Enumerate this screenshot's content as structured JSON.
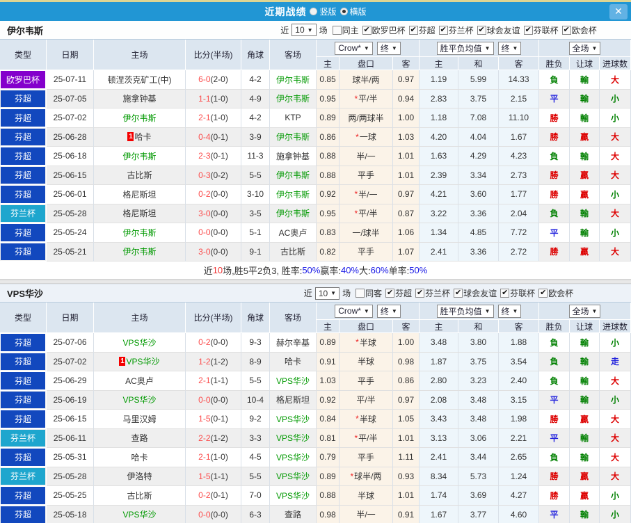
{
  "window": {
    "title": "近期战绩",
    "views": [
      {
        "label": "竖版",
        "selected": false
      },
      {
        "label": "横版",
        "selected": true
      }
    ],
    "close_icon": "✕"
  },
  "columns": {
    "left": [
      "类型",
      "日期",
      "主场",
      "比分(半场)",
      "角球",
      "客场"
    ],
    "sub": [
      "主",
      "盘口",
      "客",
      "主",
      "和",
      "客",
      "胜负",
      "让球",
      "进球数"
    ],
    "selects": {
      "odds_source": "Crow*",
      "odds_state": "终",
      "avg_source": "胜平负均值",
      "avg_state": "终",
      "scope": "全场"
    },
    "dropdown_icon": "▼",
    "check_icon": "✔"
  },
  "colors": {
    "titlebar": "#2196d4",
    "score_red": "#fb4b4b",
    "team_green": "#009900",
    "league": {
      "芬超": "#1248be",
      "芬兰杯": "#1ea6ce",
      "欧罗巴杯": "#8400cc"
    },
    "outcome": {
      "勝": "#dd0000",
      "贏": "#dd0000",
      "大": "#dd0000",
      "負": "#008000",
      "輸": "#008000",
      "小": "#008000",
      "平": "#2222dd",
      "走": "#2222dd"
    },
    "summary": {
      "dark": "#333333",
      "red": "#ee3333",
      "blue": "#1818e6"
    }
  },
  "sections": [
    {
      "team": "伊尔韦斯",
      "filter": {
        "prefix": "近",
        "count": "10",
        "suffix": "场",
        "same_label": "同主",
        "same_checked": false,
        "leagues": [
          {
            "label": "欧罗巴杯",
            "checked": true
          },
          {
            "label": "芬超",
            "checked": true
          },
          {
            "label": "芬兰杯",
            "checked": true
          },
          {
            "label": "球会友谊",
            "checked": true
          },
          {
            "label": "芬联杯",
            "checked": true
          },
          {
            "label": "欧会杯",
            "checked": true
          }
        ]
      },
      "rows": [
        {
          "type": "欧罗巴杯",
          "date": "25-07-11",
          "home": {
            "name": "顿涅茨克矿工(中)",
            "self": false,
            "card": false
          },
          "score": "6-0",
          "half": "(2-0)",
          "corner": "4-2",
          "away": {
            "name": "伊尔韦斯",
            "self": true,
            "card": false
          },
          "crow": {
            "home": "0.85",
            "star": false,
            "handicap": "球半/两",
            "away": "0.97"
          },
          "avg": {
            "home": "1.19",
            "draw": "5.99",
            "away": "14.33"
          },
          "result": "負",
          "spread": "輸",
          "goals": "大"
        },
        {
          "type": "芬超",
          "date": "25-07-05",
          "home": {
            "name": "施拿钟基",
            "self": false,
            "card": false
          },
          "score": "1-1",
          "half": "(1-0)",
          "corner": "4-9",
          "away": {
            "name": "伊尔韦斯",
            "self": true,
            "card": false
          },
          "crow": {
            "home": "0.95",
            "star": true,
            "handicap": "平/半",
            "away": "0.94"
          },
          "avg": {
            "home": "2.83",
            "draw": "3.75",
            "away": "2.15"
          },
          "result": "平",
          "spread": "輸",
          "goals": "小"
        },
        {
          "type": "芬超",
          "date": "25-07-02",
          "home": {
            "name": "伊尔韦斯",
            "self": true,
            "card": false
          },
          "score": "2-1",
          "half": "(1-0)",
          "corner": "4-2",
          "away": {
            "name": "KTP",
            "self": false,
            "card": false
          },
          "crow": {
            "home": "0.89",
            "star": false,
            "handicap": "两/两球半",
            "away": "1.00"
          },
          "avg": {
            "home": "1.18",
            "draw": "7.08",
            "away": "11.10"
          },
          "result": "勝",
          "spread": "輸",
          "goals": "小"
        },
        {
          "type": "芬超",
          "date": "25-06-28",
          "home": {
            "name": "哈卡",
            "self": false,
            "card": true
          },
          "score": "0-4",
          "half": "(0-1)",
          "corner": "3-9",
          "away": {
            "name": "伊尔韦斯",
            "self": true,
            "card": false
          },
          "crow": {
            "home": "0.86",
            "star": true,
            "handicap": "一球",
            "away": "1.03"
          },
          "avg": {
            "home": "4.20",
            "draw": "4.04",
            "away": "1.67"
          },
          "result": "勝",
          "spread": "贏",
          "goals": "大"
        },
        {
          "type": "芬超",
          "date": "25-06-18",
          "home": {
            "name": "伊尔韦斯",
            "self": true,
            "card": false
          },
          "score": "2-3",
          "half": "(0-1)",
          "corner": "11-3",
          "away": {
            "name": "施拿钟基",
            "self": false,
            "card": false
          },
          "crow": {
            "home": "0.88",
            "star": false,
            "handicap": "半/一",
            "away": "1.01"
          },
          "avg": {
            "home": "1.63",
            "draw": "4.29",
            "away": "4.23"
          },
          "result": "負",
          "spread": "輸",
          "goals": "大"
        },
        {
          "type": "芬超",
          "date": "25-06-15",
          "home": {
            "name": "古比斯",
            "self": false,
            "card": false
          },
          "score": "0-3",
          "half": "(0-2)",
          "corner": "5-5",
          "away": {
            "name": "伊尔韦斯",
            "self": true,
            "card": false
          },
          "crow": {
            "home": "0.88",
            "star": false,
            "handicap": "平手",
            "away": "1.01"
          },
          "avg": {
            "home": "2.39",
            "draw": "3.34",
            "away": "2.73"
          },
          "result": "勝",
          "spread": "贏",
          "goals": "大"
        },
        {
          "type": "芬超",
          "date": "25-06-01",
          "home": {
            "name": "格尼斯坦",
            "self": false,
            "card": false
          },
          "score": "0-2",
          "half": "(0-0)",
          "corner": "3-10",
          "away": {
            "name": "伊尔韦斯",
            "self": true,
            "card": false
          },
          "crow": {
            "home": "0.92",
            "star": true,
            "handicap": "半/一",
            "away": "0.97"
          },
          "avg": {
            "home": "4.21",
            "draw": "3.60",
            "away": "1.77"
          },
          "result": "勝",
          "spread": "贏",
          "goals": "小"
        },
        {
          "type": "芬兰杯",
          "date": "25-05-28",
          "home": {
            "name": "格尼斯坦",
            "self": false,
            "card": false
          },
          "score": "3-0",
          "half": "(0-0)",
          "corner": "3-5",
          "away": {
            "name": "伊尔韦斯",
            "self": true,
            "card": false
          },
          "crow": {
            "home": "0.95",
            "star": true,
            "handicap": "平/半",
            "away": "0.87"
          },
          "avg": {
            "home": "3.22",
            "draw": "3.36",
            "away": "2.04"
          },
          "result": "負",
          "spread": "輸",
          "goals": "大"
        },
        {
          "type": "芬超",
          "date": "25-05-24",
          "home": {
            "name": "伊尔韦斯",
            "self": true,
            "card": false
          },
          "score": "0-0",
          "half": "(0-0)",
          "corner": "5-1",
          "away": {
            "name": "AC奥卢",
            "self": false,
            "card": false
          },
          "crow": {
            "home": "0.83",
            "star": false,
            "handicap": "一/球半",
            "away": "1.06"
          },
          "avg": {
            "home": "1.34",
            "draw": "4.85",
            "away": "7.72"
          },
          "result": "平",
          "spread": "輸",
          "goals": "小"
        },
        {
          "type": "芬超",
          "date": "25-05-21",
          "home": {
            "name": "伊尔韦斯",
            "self": true,
            "card": false
          },
          "score": "3-0",
          "half": "(0-0)",
          "corner": "9-1",
          "away": {
            "name": "古比斯",
            "self": false,
            "card": false
          },
          "crow": {
            "home": "0.82",
            "star": false,
            "handicap": "平手",
            "away": "1.07"
          },
          "avg": {
            "home": "2.41",
            "draw": "3.36",
            "away": "2.72"
          },
          "result": "勝",
          "spread": "贏",
          "goals": "大"
        }
      ],
      "summary": [
        {
          "text": "近",
          "color": "dark"
        },
        {
          "text": "10",
          "color": "red"
        },
        {
          "text": "场,胜5平2负3, 胜率:",
          "color": "dark"
        },
        {
          "text": "50%",
          "color": "blue"
        },
        {
          "text": " 赢率:",
          "color": "dark"
        },
        {
          "text": "40%",
          "color": "blue"
        },
        {
          "text": " 大:",
          "color": "dark"
        },
        {
          "text": "60%",
          "color": "blue"
        },
        {
          "text": " 单率:",
          "color": "dark"
        },
        {
          "text": "50%",
          "color": "blue"
        }
      ]
    },
    {
      "team": "VPS华沙",
      "filter": {
        "prefix": "近",
        "count": "10",
        "suffix": "场",
        "same_label": "同客",
        "same_checked": false,
        "leagues": [
          {
            "label": "芬超",
            "checked": true
          },
          {
            "label": "芬兰杯",
            "checked": true
          },
          {
            "label": "球会友谊",
            "checked": true
          },
          {
            "label": "芬联杯",
            "checked": true
          },
          {
            "label": "欧会杯",
            "checked": true
          }
        ]
      },
      "rows": [
        {
          "type": "芬超",
          "date": "25-07-06",
          "home": {
            "name": "VPS华沙",
            "self": true,
            "card": false
          },
          "score": "0-2",
          "half": "(0-0)",
          "corner": "9-3",
          "away": {
            "name": "赫尔辛基",
            "self": false,
            "card": false
          },
          "crow": {
            "home": "0.89",
            "star": true,
            "handicap": "半球",
            "away": "1.00"
          },
          "avg": {
            "home": "3.48",
            "draw": "3.80",
            "away": "1.88"
          },
          "result": "負",
          "spread": "輸",
          "goals": "小"
        },
        {
          "type": "芬超",
          "date": "25-07-02",
          "home": {
            "name": "VPS华沙",
            "self": true,
            "card": true
          },
          "score": "1-2",
          "half": "(1-2)",
          "corner": "8-9",
          "away": {
            "name": "哈卡",
            "self": false,
            "card": false
          },
          "crow": {
            "home": "0.91",
            "star": false,
            "handicap": "半球",
            "away": "0.98"
          },
          "avg": {
            "home": "1.87",
            "draw": "3.75",
            "away": "3.54"
          },
          "result": "負",
          "spread": "輸",
          "goals": "走"
        },
        {
          "type": "芬超",
          "date": "25-06-29",
          "home": {
            "name": "AC奥卢",
            "self": false,
            "card": false
          },
          "score": "2-1",
          "half": "(1-1)",
          "corner": "5-5",
          "away": {
            "name": "VPS华沙",
            "self": true,
            "card": false
          },
          "crow": {
            "home": "1.03",
            "star": false,
            "handicap": "平手",
            "away": "0.86"
          },
          "avg": {
            "home": "2.80",
            "draw": "3.23",
            "away": "2.40"
          },
          "result": "負",
          "spread": "輸",
          "goals": "大"
        },
        {
          "type": "芬超",
          "date": "25-06-19",
          "home": {
            "name": "VPS华沙",
            "self": true,
            "card": false
          },
          "score": "0-0",
          "half": "(0-0)",
          "corner": "10-4",
          "away": {
            "name": "格尼斯坦",
            "self": false,
            "card": false
          },
          "crow": {
            "home": "0.92",
            "star": false,
            "handicap": "平/半",
            "away": "0.97"
          },
          "avg": {
            "home": "2.08",
            "draw": "3.48",
            "away": "3.15"
          },
          "result": "平",
          "spread": "輸",
          "goals": "小"
        },
        {
          "type": "芬超",
          "date": "25-06-15",
          "home": {
            "name": "马里汉姆",
            "self": false,
            "card": false
          },
          "score": "1-5",
          "half": "(0-1)",
          "corner": "9-2",
          "away": {
            "name": "VPS华沙",
            "self": true,
            "card": false
          },
          "crow": {
            "home": "0.84",
            "star": true,
            "handicap": "半球",
            "away": "1.05"
          },
          "avg": {
            "home": "3.43",
            "draw": "3.48",
            "away": "1.98"
          },
          "result": "勝",
          "spread": "贏",
          "goals": "大"
        },
        {
          "type": "芬兰杯",
          "date": "25-06-11",
          "home": {
            "name": "查路",
            "self": false,
            "card": false
          },
          "score": "2-2",
          "half": "(1-2)",
          "corner": "3-3",
          "away": {
            "name": "VPS华沙",
            "self": true,
            "card": false
          },
          "crow": {
            "home": "0.81",
            "star": true,
            "handicap": "平/半",
            "away": "1.01"
          },
          "avg": {
            "home": "3.13",
            "draw": "3.06",
            "away": "2.21"
          },
          "result": "平",
          "spread": "輸",
          "goals": "大"
        },
        {
          "type": "芬超",
          "date": "25-05-31",
          "home": {
            "name": "哈卡",
            "self": false,
            "card": false
          },
          "score": "2-1",
          "half": "(1-0)",
          "corner": "4-5",
          "away": {
            "name": "VPS华沙",
            "self": true,
            "card": false
          },
          "crow": {
            "home": "0.79",
            "star": false,
            "handicap": "平手",
            "away": "1.11"
          },
          "avg": {
            "home": "2.41",
            "draw": "3.44",
            "away": "2.65"
          },
          "result": "負",
          "spread": "輸",
          "goals": "大"
        },
        {
          "type": "芬兰杯",
          "date": "25-05-28",
          "home": {
            "name": "伊洛特",
            "self": false,
            "card": false
          },
          "score": "1-5",
          "half": "(1-1)",
          "corner": "5-5",
          "away": {
            "name": "VPS华沙",
            "self": true,
            "card": false
          },
          "crow": {
            "home": "0.89",
            "star": true,
            "handicap": "球半/两",
            "away": "0.93"
          },
          "avg": {
            "home": "8.34",
            "draw": "5.73",
            "away": "1.24"
          },
          "result": "勝",
          "spread": "贏",
          "goals": "大"
        },
        {
          "type": "芬超",
          "date": "25-05-25",
          "home": {
            "name": "古比斯",
            "self": false,
            "card": false
          },
          "score": "0-2",
          "half": "(0-1)",
          "corner": "7-0",
          "away": {
            "name": "VPS华沙",
            "self": true,
            "card": false
          },
          "crow": {
            "home": "0.88",
            "star": false,
            "handicap": "半球",
            "away": "1.01"
          },
          "avg": {
            "home": "1.74",
            "draw": "3.69",
            "away": "4.27"
          },
          "result": "勝",
          "spread": "贏",
          "goals": "小"
        },
        {
          "type": "芬超",
          "date": "25-05-18",
          "home": {
            "name": "VPS华沙",
            "self": true,
            "card": false
          },
          "score": "0-0",
          "half": "(0-0)",
          "corner": "6-3",
          "away": {
            "name": "查路",
            "self": false,
            "card": false
          },
          "crow": {
            "home": "0.98",
            "star": false,
            "handicap": "半/一",
            "away": "0.91"
          },
          "avg": {
            "home": "1.67",
            "draw": "3.77",
            "away": "4.60"
          },
          "result": "平",
          "spread": "輸",
          "goals": "小"
        }
      ]
    }
  ]
}
